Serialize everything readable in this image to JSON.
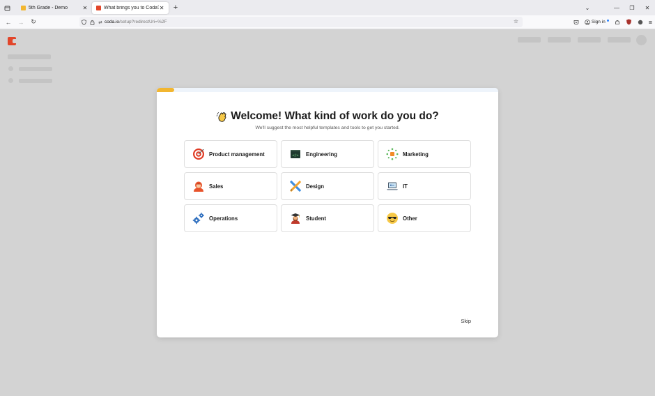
{
  "browser": {
    "tabs": [
      {
        "title": "5th Grade - Demo",
        "favicon": "coda-yellow-icon",
        "active": false
      },
      {
        "title": "What brings you to Coda?",
        "favicon": "coda-red-icon",
        "active": true
      }
    ],
    "url": {
      "host": "coda.io",
      "path": "/setup?redirectUri=%2F"
    },
    "signin_label": "Sign in"
  },
  "modal": {
    "progress_percent": 5,
    "title": "Welcome! What kind of work do you do?",
    "subtitle": "We'll suggest the most helpful templates and tools to get you started.",
    "options": [
      {
        "label": "Product management",
        "icon": "target-icon"
      },
      {
        "label": "Engineering",
        "icon": "code-terminal-icon"
      },
      {
        "label": "Marketing",
        "icon": "megaphone-burst-icon"
      },
      {
        "label": "Sales",
        "icon": "person-icon"
      },
      {
        "label": "Design",
        "icon": "ruler-pencil-icon"
      },
      {
        "label": "IT",
        "icon": "laptop-icon"
      },
      {
        "label": "Operations",
        "icon": "gears-icon"
      },
      {
        "label": "Student",
        "icon": "graduate-icon"
      },
      {
        "label": "Other",
        "icon": "sunglasses-face-icon"
      }
    ],
    "skip_label": "Skip"
  },
  "colors": {
    "accent_progress": "#f2b630",
    "coda_brand": "#e2462a",
    "page_overlay": "#d3d3d3"
  }
}
